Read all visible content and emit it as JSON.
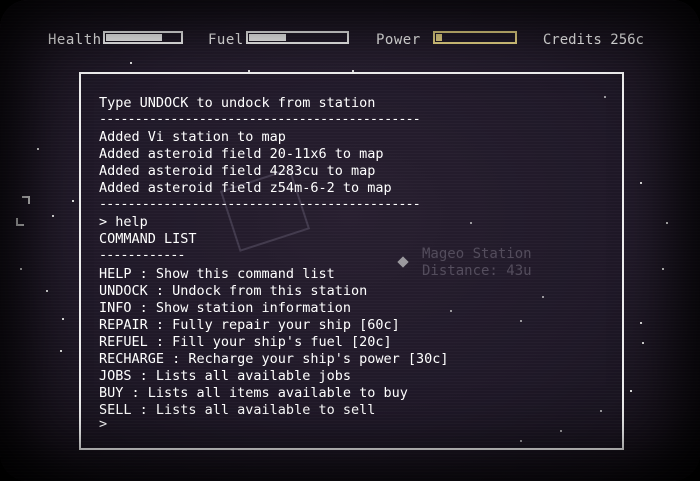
{
  "hud": {
    "health_label": "Health",
    "health_level": 0.75,
    "fuel_label": "Fuel",
    "fuel_level": 0.38,
    "power_label": "Power",
    "power_level": 0.08,
    "power_color": "#f4e08c",
    "credits": "Credits 256c"
  },
  "map": {
    "station_name": "Mageo Station",
    "station_distance": "Distance: 43u"
  },
  "terminal": {
    "header": "Type UNDOCK to undock from station",
    "divider1": "---------------------------------------------",
    "log": [
      "Added Vi station to map",
      "Added asteroid field 20-11x6 to map",
      "Added asteroid field 4283cu to map",
      "Added asteroid field z54m-6-2 to map"
    ],
    "divider2": "---------------------------------------------",
    "prompt_input": "> help",
    "list_title": "COMMAND LIST",
    "list_underline": "------------",
    "commands": [
      "HELP : Show this command list",
      "UNDOCK : Undock from this station",
      "INFO : Show station information",
      "REPAIR : Fully repair your ship [60c]",
      "REFUEL : Fill your ship's fuel [20c]",
      "RECHARGE : Recharge your ship's power [30c]",
      "JOBS : Lists all available jobs",
      "BUY : Lists all items available to buy",
      "SELL : Lists all available to sell"
    ],
    "prompt": ">"
  }
}
